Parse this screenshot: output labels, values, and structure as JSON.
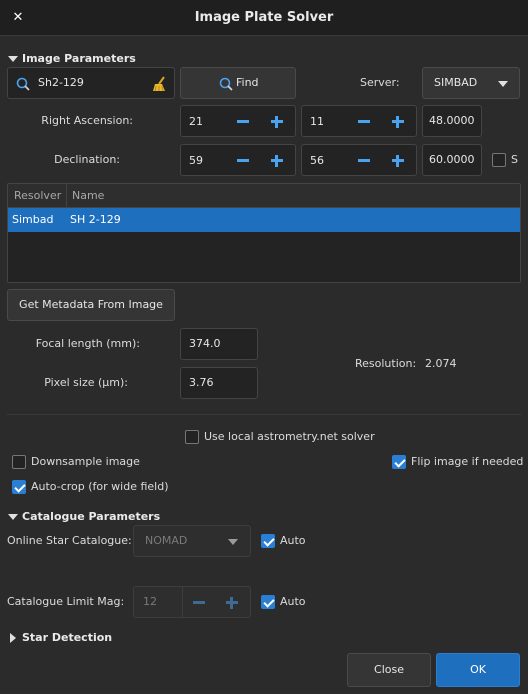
{
  "window": {
    "title": "Image Plate Solver",
    "close_glyph": "✕"
  },
  "image_params": {
    "section_label": "Image Parameters",
    "object_name": "Sh2-129",
    "find_label": "Find",
    "server_label": "Server:",
    "server_value": "SIMBAD",
    "ra_label": "Right Ascension:",
    "ra_h": "21",
    "ra_m": "11",
    "ra_s": "48.0000",
    "dec_label": "Declination:",
    "dec_d": "59",
    "dec_m": "56",
    "dec_s": "60.0000",
    "south_label": "S"
  },
  "resolver_table": {
    "headers": [
      "Resolver",
      "Name"
    ],
    "rows": [
      {
        "resolver": "Simbad",
        "name": "SH  2-129",
        "selected": true
      }
    ]
  },
  "metadata": {
    "button_label": "Get Metadata From Image",
    "focal_label": "Focal length (mm):",
    "focal_value": "374.0",
    "pixel_label": "Pixel size (µm):",
    "pixel_value": "3.76",
    "resolution_label": "Resolution:",
    "resolution_value": "2.074"
  },
  "options": {
    "local_solver_label": "Use local astrometry.net solver",
    "local_solver_checked": false,
    "downsample_label": "Downsample image",
    "downsample_checked": false,
    "flip_label": "Flip image if needed",
    "flip_checked": true,
    "autocrop_label": "Auto-crop (for wide field)",
    "autocrop_checked": true
  },
  "catalogue": {
    "section_label": "Catalogue Parameters",
    "online_label": "Online Star Catalogue:",
    "online_value": "NOMAD",
    "auto1_label": "Auto",
    "auto1_checked": true,
    "limit_label": "Catalogue Limit Mag:",
    "limit_value": "12",
    "auto2_label": "Auto",
    "auto2_checked": true
  },
  "star_detection": {
    "section_label": "Star Detection"
  },
  "footer": {
    "close_label": "Close",
    "ok_label": "OK"
  },
  "colors": {
    "accent": "#2a7fd4",
    "selection": "#1f6fbf",
    "ok_button": "#1f6fbf",
    "spin_icon": "#4aa3f0"
  }
}
